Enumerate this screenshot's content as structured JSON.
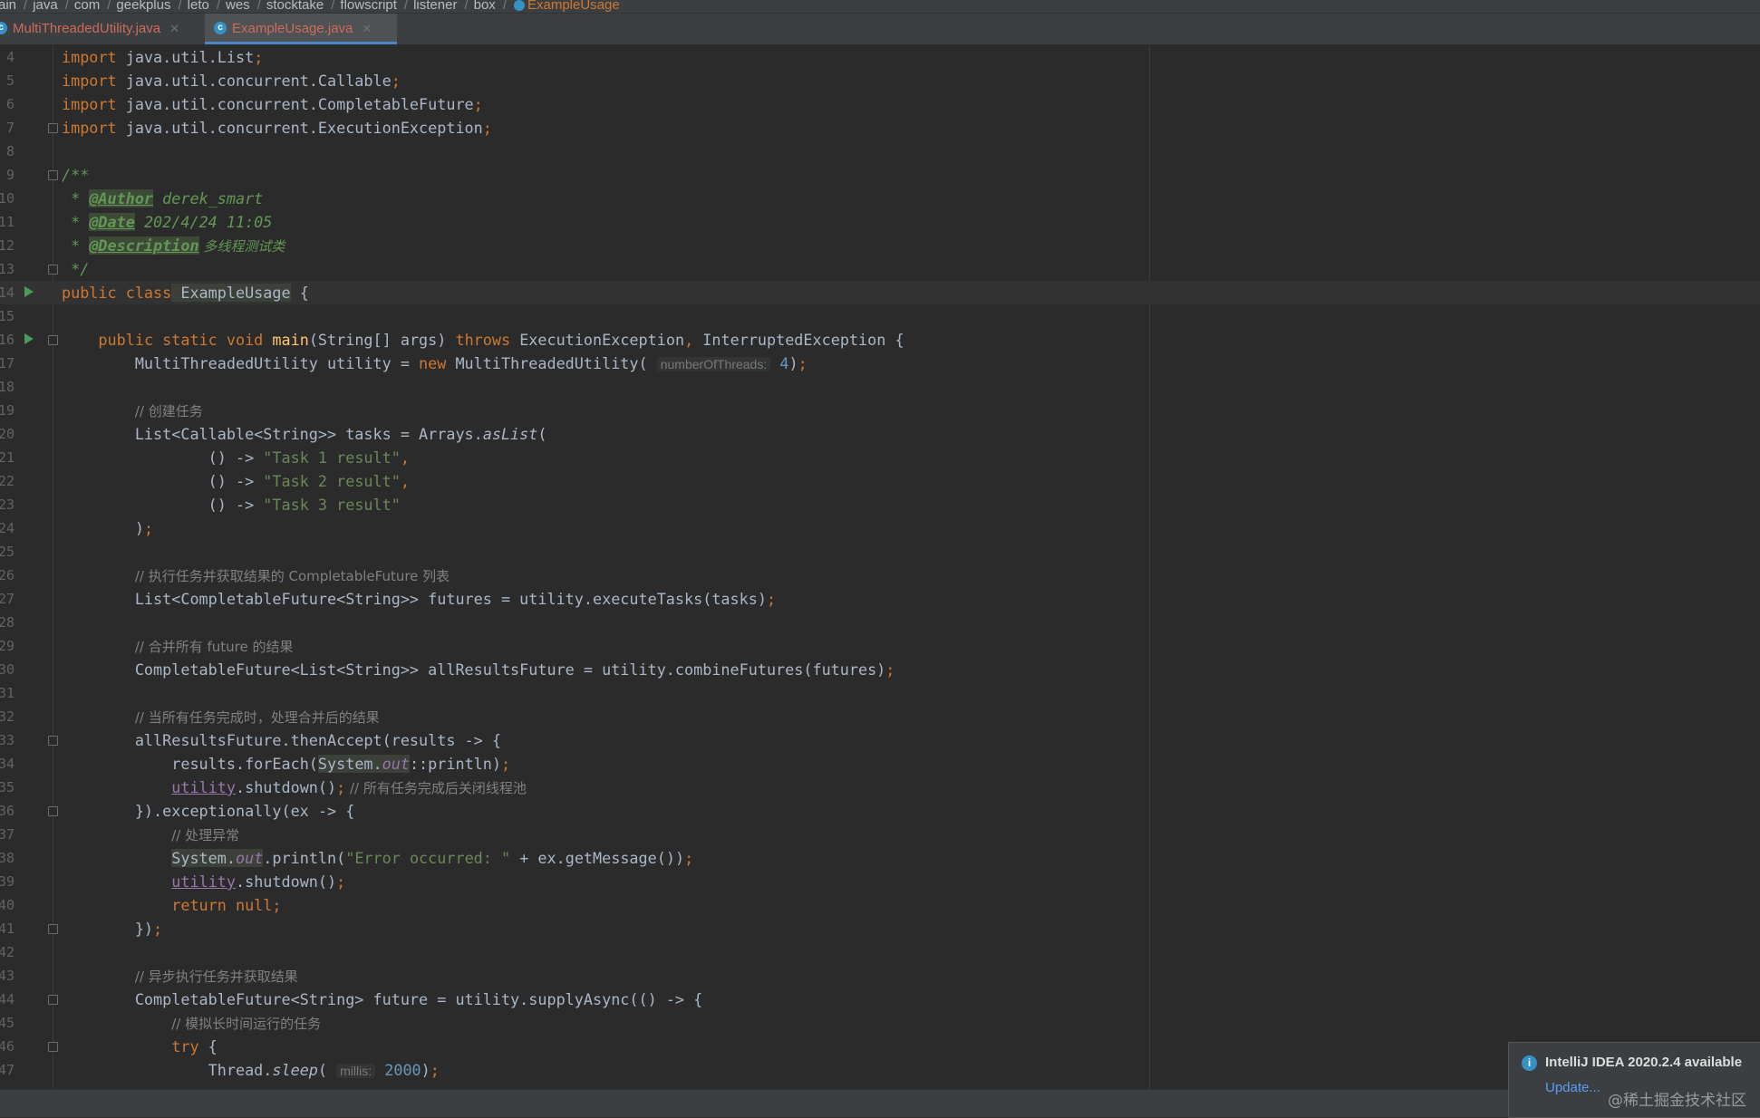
{
  "breadcrumb": {
    "items": [
      "ain",
      "java",
      "com",
      "geekplus",
      "leto",
      "wes",
      "stocktake",
      "flowscript",
      "listener",
      "box"
    ],
    "current": "ExampleUsage"
  },
  "tabs": [
    {
      "label": "MultiThreadedUtility.java",
      "active": false
    },
    {
      "label": "ExampleUsage.java",
      "active": true
    }
  ],
  "editor": {
    "line_numbers": [
      "4",
      "5",
      "6",
      "7",
      "8",
      "9",
      "10",
      "11",
      "12",
      "13",
      "14",
      "15",
      "16",
      "17",
      "18",
      "19",
      "20",
      "21",
      "22",
      "23",
      "24",
      "25",
      "26",
      "27",
      "28",
      "29",
      "30",
      "31",
      "32",
      "33",
      "34",
      "35",
      "36",
      "37",
      "38",
      "39",
      "40",
      "41",
      "42",
      "43",
      "44",
      "45",
      "46",
      "47"
    ],
    "code": {
      "l4": {
        "kw": "import",
        "rest": " java.util.List",
        "semi": ";"
      },
      "l5": {
        "kw": "import",
        "rest": " java.util.concurrent.Callable",
        "semi": ";"
      },
      "l6": {
        "kw": "import",
        "rest": " java.util.concurrent.CompletableFuture",
        "semi": ";"
      },
      "l7": {
        "kw": "import",
        "rest": " java.util.concurrent.ExecutionException",
        "semi": ";"
      },
      "l9": "/**",
      "l10": {
        "star": " * ",
        "tag": "@Author",
        "val": " derek_smart"
      },
      "l11": {
        "star": " * ",
        "tag": "@Date",
        "val": " 202/4/24 11:05"
      },
      "l12": {
        "star": " * ",
        "tag": "@Description",
        "val": " 多线程测试类"
      },
      "l13": " */",
      "l14": {
        "kw": "public class",
        "name": " ExampleUsage",
        "rest": " {"
      },
      "l16": {
        "indent": "    ",
        "kw1": "public static void",
        "fn": " main",
        "mid": "(String[] args) ",
        "kw2": "throws",
        "rest": " ExecutionException",
        "comma": ",",
        "rest2": " InterruptedException {"
      },
      "l17": {
        "indent": "        ",
        "a": "MultiThreadedUtility utility = ",
        "kw": "new",
        "b": " MultiThreadedUtility(",
        "hint": "numberOfThreads:",
        "num": "4",
        "c": ")",
        "semi": ";"
      },
      "l19": {
        "indent": "        ",
        "comment": "// 创建任务"
      },
      "l20": {
        "indent": "        ",
        "a": "List<Callable<String>> tasks = Arrays.",
        "it": "asList",
        "b": "("
      },
      "l21": {
        "indent": "                ",
        "a": "() -> ",
        "str": "\"Task 1 result\"",
        "comma": ","
      },
      "l22": {
        "indent": "                ",
        "a": "() -> ",
        "str": "\"Task 2 result\"",
        "comma": ","
      },
      "l23": {
        "indent": "                ",
        "a": "() -> ",
        "str": "\"Task 3 result\""
      },
      "l24": {
        "indent": "        ",
        "a": ")",
        "semi": ";"
      },
      "l26": {
        "indent": "        ",
        "comment": "// 执行任务并获取结果的 CompletableFuture 列表"
      },
      "l27": {
        "indent": "        ",
        "a": "List<CompletableFuture<String>> futures = utility.executeTasks(tasks)",
        "semi": ";"
      },
      "l29": {
        "indent": "        ",
        "comment": "// 合并所有 future 的结果"
      },
      "l30": {
        "indent": "        ",
        "a": "CompletableFuture<List<String>> allResultsFuture = utility.combineFutures(futures)",
        "semi": ";"
      },
      "l32": {
        "indent": "        ",
        "comment": "// 当所有任务完成时，处理合并后的结果"
      },
      "l33": {
        "indent": "        ",
        "a": "allResultsFuture.thenAccept(results -> {"
      },
      "l34": {
        "indent": "            ",
        "a": "results.forEach(",
        "sys": "System.",
        "out": "out",
        "b": "::println)",
        "semi": ";"
      },
      "l35": {
        "indent": "            ",
        "fld": "utility",
        "a": ".shutdown()",
        "semi": ";",
        "comment": " // 所有任务完成后关闭线程池"
      },
      "l36": {
        "indent": "        ",
        "a": "}).exceptionally(ex -> {"
      },
      "l37": {
        "indent": "            ",
        "comment": "// 处理异常"
      },
      "l38": {
        "indent": "            ",
        "sys": "System.",
        "out": "out",
        "a": ".println(",
        "str": "\"Error occurred: \"",
        "b": " + ex.getMessage())",
        "semi": ";"
      },
      "l39": {
        "indent": "            ",
        "fld": "utility",
        "a": ".shutdown()",
        "semi": ";"
      },
      "l40": {
        "indent": "            ",
        "kw": "return null",
        "semi": ";"
      },
      "l41": {
        "indent": "        ",
        "a": "})",
        "semi": ";"
      },
      "l43": {
        "indent": "        ",
        "comment": "// 异步执行任务并获取结果"
      },
      "l44": {
        "indent": "        ",
        "a": "CompletableFuture<String> future = utility.supplyAsync(() -> {"
      },
      "l45": {
        "indent": "            ",
        "comment": "// 模拟长时间运行的任务"
      },
      "l46": {
        "indent": "            ",
        "kw": "try",
        "a": " {"
      },
      "l47": {
        "indent": "                ",
        "a": "Thread.",
        "it": "sleep",
        "b": "(",
        "hint": "millis:",
        "num": "2000",
        "c": ")",
        "semi": ";"
      }
    }
  },
  "notification": {
    "title": "IntelliJ IDEA 2020.2.4 available",
    "link": "Update..."
  },
  "watermark": "@稀土掘金技术社区",
  "colors": {
    "background": "#2b2b2b",
    "keyword": "#cc7832",
    "string": "#6a8759",
    "comment": "#808080",
    "doc": "#629755",
    "method": "#ffc66d",
    "field": "#9876aa",
    "number": "#6897bb"
  },
  "icons": {
    "file_tab": "java-class-icon",
    "run_gutter": "run-arrow-icon",
    "fold": "fold-marker-icon",
    "notification": "info-icon"
  }
}
